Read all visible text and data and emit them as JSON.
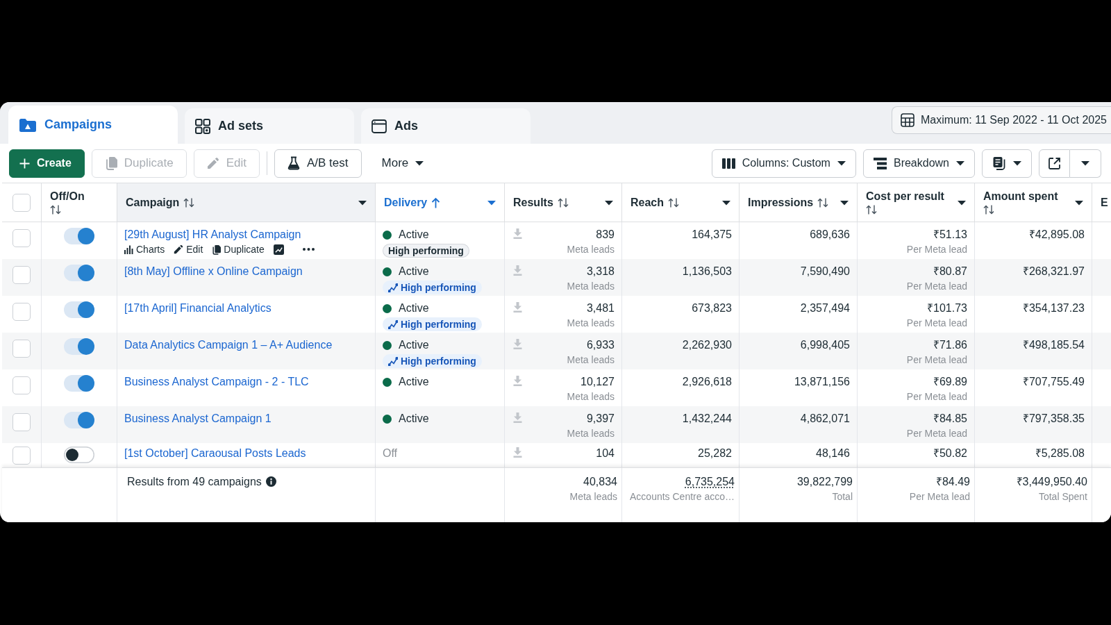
{
  "tabs": [
    {
      "label": "Campaigns",
      "selected": true
    },
    {
      "label": "Ad sets",
      "selected": false
    },
    {
      "label": "Ads",
      "selected": false
    }
  ],
  "date_range": {
    "label": "Maximum: 11 Sep 2022 - 11 Oct 2025"
  },
  "toolbar": {
    "actions": [
      [
        {
          "label": "Create",
          "kind": "primary",
          "disabled": false
        },
        {
          "label": "Duplicate",
          "kind": "outline",
          "disabled": true
        },
        {
          "label": "Edit",
          "kind": "outline",
          "disabled": true
        }
      ],
      [
        {
          "label": "A/B test",
          "kind": "outline",
          "disabled": false
        },
        {
          "label": "More",
          "kind": "menu",
          "disabled": false
        }
      ]
    ],
    "view": [
      {
        "label": "Columns: Custom",
        "kind": "dropdown"
      },
      {
        "label": "Breakdown",
        "kind": "dropdown"
      },
      {
        "kind": "icon_dropdown"
      },
      {
        "kind": "split"
      }
    ]
  },
  "table": {
    "select_all": {
      "checked": false
    },
    "columns": [
      {
        "label": "Off/On",
        "sorted": false,
        "menu": false
      },
      {
        "label": "Campaign",
        "sorted": false,
        "menu": true
      },
      {
        "label": "Delivery",
        "sorted": true,
        "menu": true
      },
      {
        "label": "Results",
        "sorted": false,
        "menu": true
      },
      {
        "label": "Reach",
        "sorted": false,
        "menu": true
      },
      {
        "label": "Impressions",
        "sorted": false,
        "menu": true
      },
      {
        "label": "Cost per result",
        "sorted": false,
        "menu": true
      },
      {
        "label": "Amount spent",
        "sorted": false,
        "menu": true
      },
      {
        "label": "E"
      }
    ],
    "rows": [
      {
        "selected": false,
        "on": true,
        "campaign": "[29th August] HR Analyst Campaign",
        "actions": [
          {
            "kind": "link",
            "label": "Charts"
          },
          {
            "kind": "link",
            "label": "Edit"
          },
          {
            "kind": "link",
            "label": "Duplicate"
          },
          {
            "kind": "icon"
          },
          {
            "kind": "icon"
          }
        ],
        "delivery": {
          "status": "Active",
          "kind": "active"
        },
        "badge": {
          "label": "High performing",
          "kind": "plain"
        },
        "results": "839",
        "results_note": "Meta leads",
        "reach": "164,375",
        "impressions": "689,636",
        "cost_per_result": "₹51.13",
        "cost_note": "Per Meta lead",
        "amount_spent": "₹42,895.08"
      },
      {
        "selected": false,
        "on": true,
        "campaign": "[8th May] Offline x Online Campaign",
        "delivery": {
          "status": "Active",
          "kind": "active"
        },
        "badge": {
          "label": "High performing",
          "kind": "trend"
        },
        "results": "3,318",
        "results_note": "Meta leads",
        "reach": "1,136,503",
        "impressions": "7,590,490",
        "cost_per_result": "₹80.87",
        "cost_note": "Per Meta lead",
        "amount_spent": "₹268,321.97"
      },
      {
        "selected": false,
        "on": true,
        "campaign": "[17th April] Financial Analytics",
        "delivery": {
          "status": "Active",
          "kind": "active"
        },
        "badge": {
          "label": "High performing",
          "kind": "trend"
        },
        "results": "3,481",
        "results_note": "Meta leads",
        "reach": "673,823",
        "impressions": "2,357,494",
        "cost_per_result": "₹101.73",
        "cost_note": "Per Meta lead",
        "amount_spent": "₹354,137.23"
      },
      {
        "selected": false,
        "on": true,
        "campaign": "Data Analytics Campaign 1 – A+ Audience",
        "delivery": {
          "status": "Active",
          "kind": "active"
        },
        "badge": {
          "label": "High performing",
          "kind": "trend"
        },
        "results": "6,933",
        "results_note": "Meta leads",
        "reach": "2,262,930",
        "impressions": "6,998,405",
        "cost_per_result": "₹71.86",
        "cost_note": "Per Meta lead",
        "amount_spent": "₹498,185.54"
      },
      {
        "selected": false,
        "on": true,
        "campaign": "Business Analyst Campaign - 2 - TLC",
        "delivery": {
          "status": "Active",
          "kind": "active"
        },
        "results": "10,127",
        "results_note": "Meta leads",
        "reach": "2,926,618",
        "impressions": "13,871,156",
        "cost_per_result": "₹69.89",
        "cost_note": "Per Meta lead",
        "amount_spent": "₹707,755.49"
      },
      {
        "selected": false,
        "on": true,
        "campaign": "Business Analyst Campaign 1",
        "delivery": {
          "status": "Active",
          "kind": "active"
        },
        "results": "9,397",
        "results_note": "Meta leads",
        "reach": "1,432,244",
        "impressions": "4,862,071",
        "cost_per_result": "₹84.85",
        "cost_note": "Per Meta lead",
        "amount_spent": "₹797,358.35"
      },
      {
        "selected": false,
        "on": false,
        "campaign": "[1st October] Caraousal Posts Leads",
        "delivery": {
          "status": "Off",
          "kind": "off"
        },
        "results": "104",
        "reach": "25,282",
        "impressions": "48,146",
        "cost_per_result": "₹50.82",
        "amount_spent": "₹5,285.08"
      }
    ],
    "footer": {
      "label": "Results from 49 campaigns",
      "results": {
        "value": "40,834",
        "note": "Meta leads"
      },
      "reach": {
        "value": "6,735,254",
        "note": "Accounts Centre acco…"
      },
      "impressions": {
        "value": "39,822,799",
        "note": "Total"
      },
      "cost_per_result": {
        "value": "₹84.49",
        "note": "Per Meta lead"
      },
      "amount_spent": {
        "value": "₹3,449,950.40",
        "note": "Total Spent"
      }
    }
  }
}
